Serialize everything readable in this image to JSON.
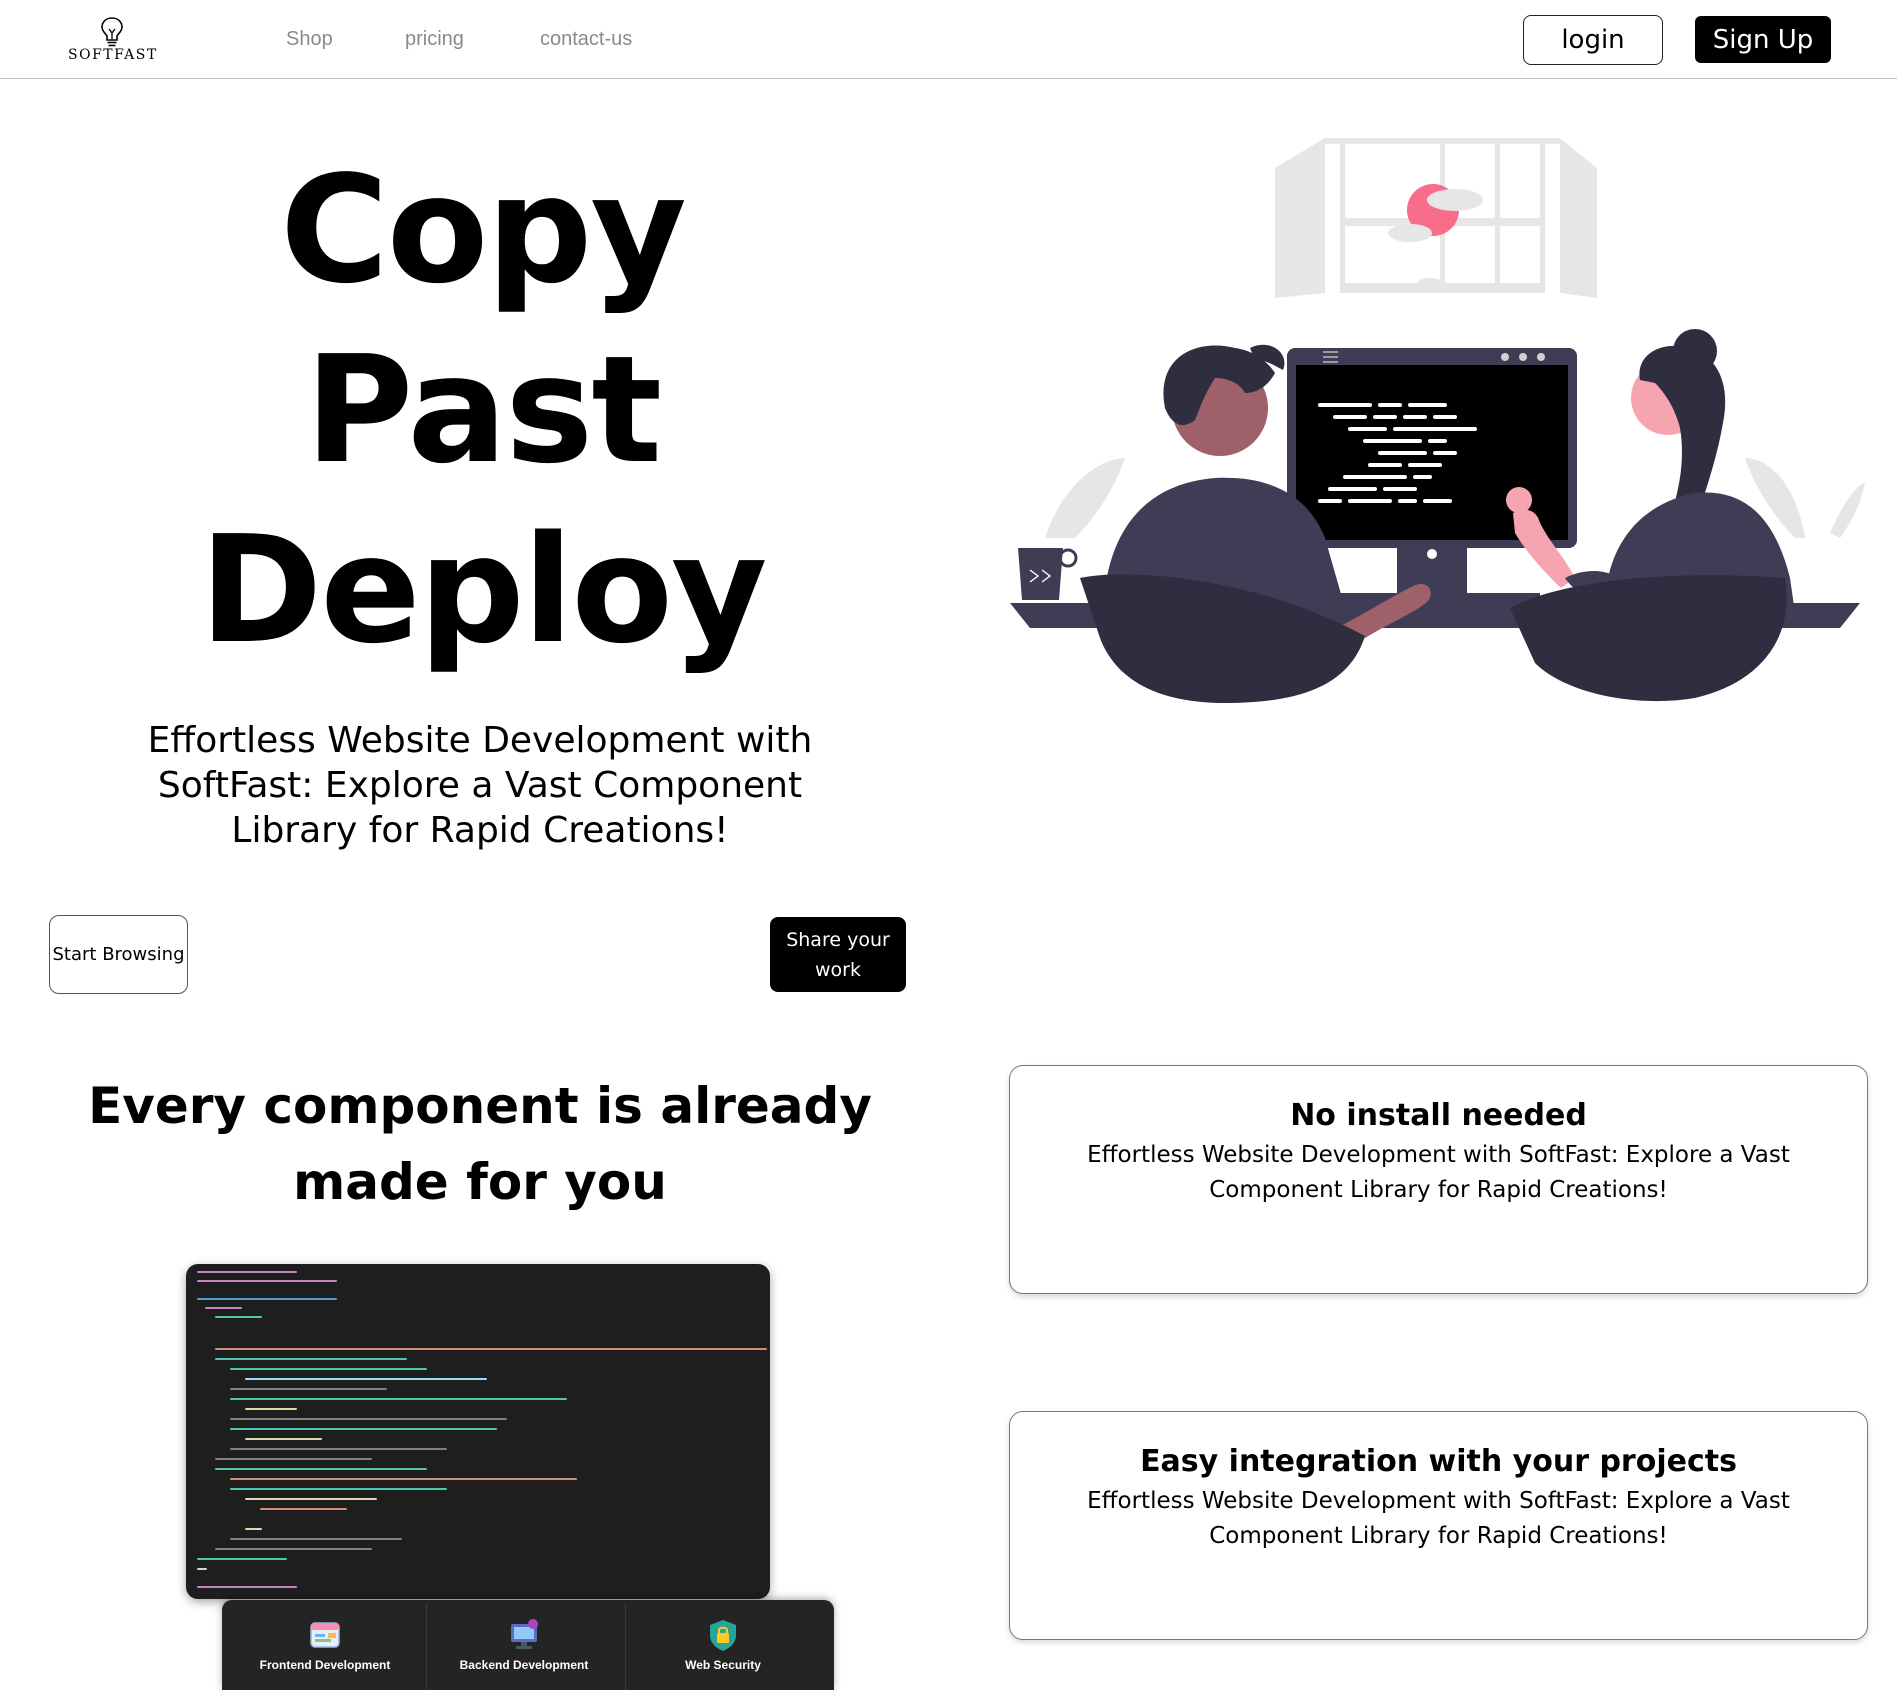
{
  "nav": {
    "logo_text": "SOFTFAST",
    "links": [
      "Shop",
      "pricing",
      "contact-us"
    ],
    "login_label": "login",
    "signup_label": "Sign Up"
  },
  "hero": {
    "title_lines": [
      "Copy",
      "Past",
      "Deploy"
    ],
    "subtitle": "Effortless Website Development with SoftFast: Explore a Vast Component Library for Rapid Creations!",
    "start_label": "Start Browsing",
    "share_label": "Share your work"
  },
  "components": {
    "heading": "Every component is already made for you",
    "skills": [
      "Frontend Development",
      "Backend Development",
      "Web Security"
    ]
  },
  "features": [
    {
      "title": "No install needed",
      "description": "Effortless Website Development with SoftFast: Explore a Vast Component Library for Rapid Creations!"
    },
    {
      "title": "Easy integration with your projects",
      "description": "Effortless Website Development with SoftFast: Explore a Vast Component Library for Rapid Creations!"
    }
  ],
  "colors": {
    "primary": "#000000",
    "muted_nav": "#8a8a8a",
    "illustration_dark": "#3f3d56",
    "illustration_accent": "#f86d8a",
    "code_bg": "#1e1e1e"
  }
}
